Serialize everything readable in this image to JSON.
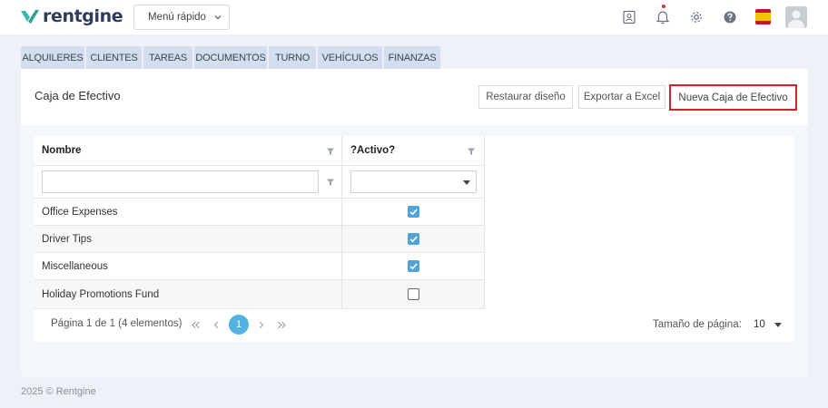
{
  "app": {
    "logo_text": "rentgine",
    "brand_color": "#3cb7b0"
  },
  "header": {
    "quick_menu_label": "Menú rápido",
    "icons": [
      "contacts-icon",
      "bell-icon",
      "gear-icon",
      "help-icon",
      "spain-flag-icon",
      "user-avatar-icon"
    ]
  },
  "tabs": [
    {
      "label": "ALQUILERES"
    },
    {
      "label": "CLIENTES"
    },
    {
      "label": "TAREAS"
    },
    {
      "label": "DOCUMENTOS"
    },
    {
      "label": "TURNO"
    },
    {
      "label": "VEHÍCULOS"
    },
    {
      "label": "FINANZAS"
    }
  ],
  "page": {
    "title": "Caja de Efectivo",
    "buttons": {
      "restore": "Restaurar diseño",
      "export": "Exportar a Excel",
      "new": "Nueva Caja de Efectivo"
    }
  },
  "grid": {
    "columns": {
      "name": "Nombre",
      "active": "?Activo?"
    },
    "filter": {
      "name_value": "",
      "active_value": ""
    },
    "rows": [
      {
        "name": "Office Expenses",
        "active": true
      },
      {
        "name": "Driver Tips",
        "active": true
      },
      {
        "name": "Miscellaneous",
        "active": true
      },
      {
        "name": "Holiday Promotions Fund",
        "active": false
      }
    ],
    "pager": {
      "info": "Página 1 de 1 (4 elementos)",
      "current_page": "1",
      "page_size_label": "Tamaño de página:",
      "page_size_value": "10"
    }
  },
  "footer": {
    "text": "2025 © Rentgine"
  },
  "colors": {
    "accent_red": "#d2232a",
    "checkbox_blue": "#4fa3d9",
    "pager_blue": "#52b3e3",
    "tab_bg": "#d3dff0"
  }
}
